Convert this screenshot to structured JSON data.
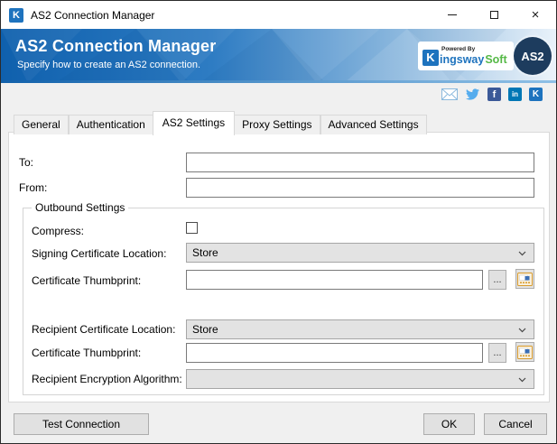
{
  "window": {
    "title": "AS2 Connection Manager",
    "app_icon_letter": "K"
  },
  "header": {
    "title": "AS2 Connection Manager",
    "subtitle": "Specify how to create an AS2 connection.",
    "badge_label": "AS2",
    "logo": {
      "k_letter": "K",
      "powered_by": "Powered By",
      "name_blue": "ingsway",
      "name_green": "Soft"
    }
  },
  "social": {
    "facebook_label": "f",
    "linkedin_label": "in",
    "kingswaysoft_label": "K"
  },
  "tabs": [
    {
      "label": "General",
      "active": false
    },
    {
      "label": "Authentication",
      "active": false
    },
    {
      "label": "AS2 Settings",
      "active": true
    },
    {
      "label": "Proxy Settings",
      "active": false
    },
    {
      "label": "Advanced Settings",
      "active": false
    }
  ],
  "form": {
    "to": {
      "label": "To:",
      "value": ""
    },
    "from": {
      "label": "From:",
      "value": ""
    },
    "outbound": {
      "title": "Outbound Settings",
      "compress": {
        "label": "Compress:",
        "checked": false
      },
      "signing_cert_location": {
        "label": "Signing Certificate Location:",
        "value": "Store"
      },
      "cert_thumbprint_1": {
        "label": "Certificate Thumbprint:",
        "value": "",
        "browse_label": "..."
      },
      "recipient_cert_location": {
        "label": "Recipient Certificate Location:",
        "value": "Store"
      },
      "cert_thumbprint_2": {
        "label": "Certificate Thumbprint:",
        "value": "",
        "browse_label": "..."
      },
      "recipient_encryption_algorithm": {
        "label": "Recipient Encryption Algorithm:",
        "value": ""
      }
    }
  },
  "footer": {
    "test_connection_label": "Test Connection",
    "ok_label": "OK",
    "cancel_label": "Cancel"
  },
  "colors": {
    "brand_blue": "#1e73be",
    "brand_green": "#56b947",
    "header_blue": "#0f60ad",
    "badge_navy": "#1d3c5e",
    "twitter_blue": "#55acee",
    "facebook_navy": "#3b5998",
    "linkedin_blue": "#0077b5"
  }
}
